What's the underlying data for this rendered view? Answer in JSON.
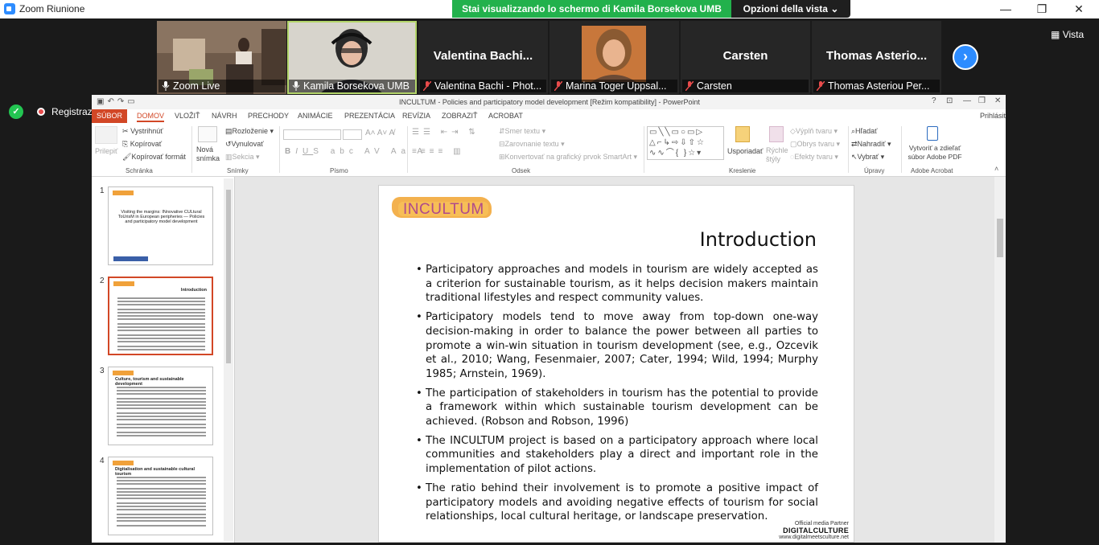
{
  "zoom": {
    "window_title": "Zoom Riunione",
    "share_banner": "Stai visualizzando lo schermo di Kamila Borsekova UMB",
    "view_options": "Opzioni della vista",
    "vista": "Vista",
    "recording_label": "Registrazione in co",
    "next_arrow": "›",
    "participants": [
      {
        "label": "Zoom Live",
        "big_name": "",
        "has_video": true
      },
      {
        "label": "Kamila Borsekova UMB",
        "big_name": "",
        "has_video": true
      },
      {
        "label": "Valentina Bachi - Phot...",
        "big_name": "Valentina Bachi...",
        "has_video": false
      },
      {
        "label": "Marina Toger Uppsal...",
        "big_name": "",
        "has_video": true
      },
      {
        "label": "Carsten",
        "big_name": "Carsten",
        "has_video": false
      },
      {
        "label": "Thomas Asteriou Per...",
        "big_name": "Thomas Asterio...",
        "has_video": false
      }
    ]
  },
  "ppt": {
    "title": "INCULTUM - Policies and participatory model development [Režim kompatibility] - PowerPoint",
    "sign_in": "Prihlásiť",
    "help": "?",
    "tabs": [
      "SÚBOR",
      "DOMOV",
      "VLOŽIŤ",
      "NÁVRH",
      "PRECHODY",
      "ANIMÁCIE",
      "PREZENTÁCIA",
      "REVÍZIA",
      "ZOBRAZIŤ",
      "ACROBAT"
    ],
    "ribbon": {
      "paste": "Prilepiť",
      "cut": "Vystrihnúť",
      "copy": "Kopírovať",
      "format_painter": "Kopírovať formát",
      "clipboard_group": "Schránka",
      "new_slide": "Nová snímka",
      "layout": "Rozloženie",
      "reset": "Vynulovať",
      "section": "Sekcia",
      "slides_group": "Snímky",
      "font_group": "Písmo",
      "text_direction": "Smer textu",
      "align_text": "Zarovnanie textu",
      "smartart": "Konvertovať na grafický prvok SmartArt",
      "paragraph_group": "Odsek",
      "arrange": "Usporiadať",
      "quick_styles": "Rýchle štýly",
      "shape_fill": "Výplň tvaru",
      "shape_outline": "Obrys tvaru",
      "shape_effects": "Efekty tvaru",
      "drawing_group": "Kreslenie",
      "find": "Hľadať",
      "replace": "Nahradiť",
      "select": "Vybrať",
      "editing_group": "Úpravy",
      "share_pdf": "Vytvoriť a zdieľať súbor Adobe PDF",
      "acrobat_group": "Adobe Acrobat"
    },
    "thumbnails": [
      {
        "num": "1",
        "title": "Visiting the margins: INnovative CULtural ToUrisM in European peripheries — Policies and participatory model development"
      },
      {
        "num": "2",
        "title": "Introduction"
      },
      {
        "num": "3",
        "title": "Culture, tourism and sustainable development"
      },
      {
        "num": "4",
        "title": "Digitalisation and sustainable cultural tourism"
      }
    ],
    "slide": {
      "brand": "INCULTUM",
      "title": "Introduction",
      "bullets": [
        "Participatory approaches and models in tourism are widely accepted as a criterion for sustainable tourism, as it helps decision makers maintain traditional lifestyles and respect community values.",
        "Participatory models tend to move away from top-down one-way decision-making in order to balance the power between all parties to promote a win-win situation in tourism development (see, e.g., Ozcevik et al., 2010; Wang, Fesenmaier, 2007; Cater, 1994; Wild, 1994; Murphy 1985; Arnstein, 1969).",
        "The participation of stakeholders in tourism has the potential to provide a framework within which sustainable tourism development can be achieved. (Robson and Robson, 1996)",
        "The INCULTUM project is based on a participatory approach where local communities and stakeholders play a direct and important role in the implementation of pilot actions.",
        "The ratio behind their involvement is to promote a positive impact of participatory models and avoiding negative effects of tourism for social relationships, local cultural heritage, or landscape preservation."
      ],
      "partner_label": "Official media Partner",
      "partner_name": "DIGITALCULTURE",
      "partner_url": "www.digitalmeetsculture.net"
    }
  },
  "colors": {
    "zoom_green": "#22b14c",
    "zoom_blue": "#2d8cff",
    "ppt_accent": "#d24726",
    "brand_orange": "#f2a93b"
  }
}
